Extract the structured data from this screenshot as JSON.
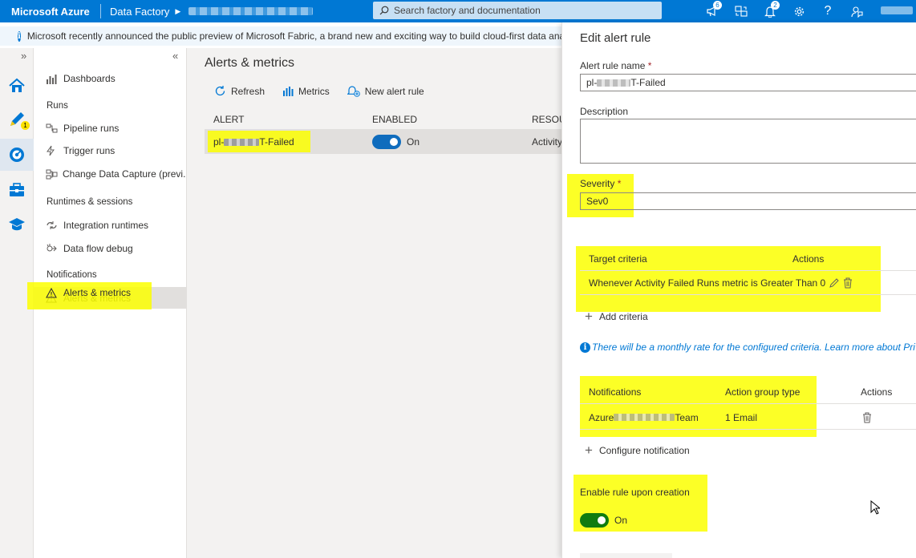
{
  "topbar": {
    "brand": "Microsoft Azure",
    "service": "Data Factory",
    "search_placeholder": "Search factory and documentation",
    "notifications_count": "6",
    "alerts_count": "2"
  },
  "banner": {
    "text": "Microsoft recently announced the public preview of Microsoft Fabric, a brand new and exciting way to build cloud-first data ana"
  },
  "rail": {
    "author_badge": "1"
  },
  "nav": {
    "items": [
      {
        "label": "Dashboards"
      },
      {
        "label": "Pipeline runs"
      },
      {
        "label": "Trigger runs"
      },
      {
        "label": "Change Data Capture (previ..."
      },
      {
        "label": "Integration runtimes"
      },
      {
        "label": "Data flow debug"
      },
      {
        "label": "Alerts & metrics"
      }
    ],
    "groups": [
      "Runs",
      "Runtimes & sessions",
      "Notifications"
    ]
  },
  "main": {
    "title": "Alerts & metrics",
    "toolbar": {
      "refresh": "Refresh",
      "metrics": "Metrics",
      "new_alert_rule": "New alert rule"
    },
    "columns": [
      "ALERT",
      "ENABLED",
      "RESOU"
    ],
    "row": {
      "alert_prefix": "pl-",
      "alert_suffix": "T-Failed",
      "enabled": "On",
      "resource": "Activity"
    }
  },
  "panel": {
    "title": "Edit alert rule",
    "name_label": "Alert rule name",
    "name_prefix": "pl-",
    "name_suffix": "T-Failed",
    "description_label": "Description",
    "severity_label": "Severity",
    "severity_value": "Sev0",
    "criteria": {
      "col_target": "Target criteria",
      "col_actions": "Actions",
      "row": "Whenever Activity Failed Runs metric is Greater Than 0"
    },
    "add_criteria": "Add criteria",
    "note": "There will be a monthly rate for the configured criteria. Learn more about Pri",
    "notifications": {
      "col_notifications": "Notifications",
      "col_type": "Action group type",
      "col_actions": "Actions",
      "row_prefix": "Azure",
      "row_suffix": "Team",
      "row_type": "1 Email"
    },
    "configure_notification": "Configure notification",
    "enable_label": "Enable rule upon creation",
    "enable_value": "On"
  },
  "colors": {
    "azure_blue": "#0078d4",
    "toggle_green": "#107c10",
    "highlight": "#fbff00"
  }
}
